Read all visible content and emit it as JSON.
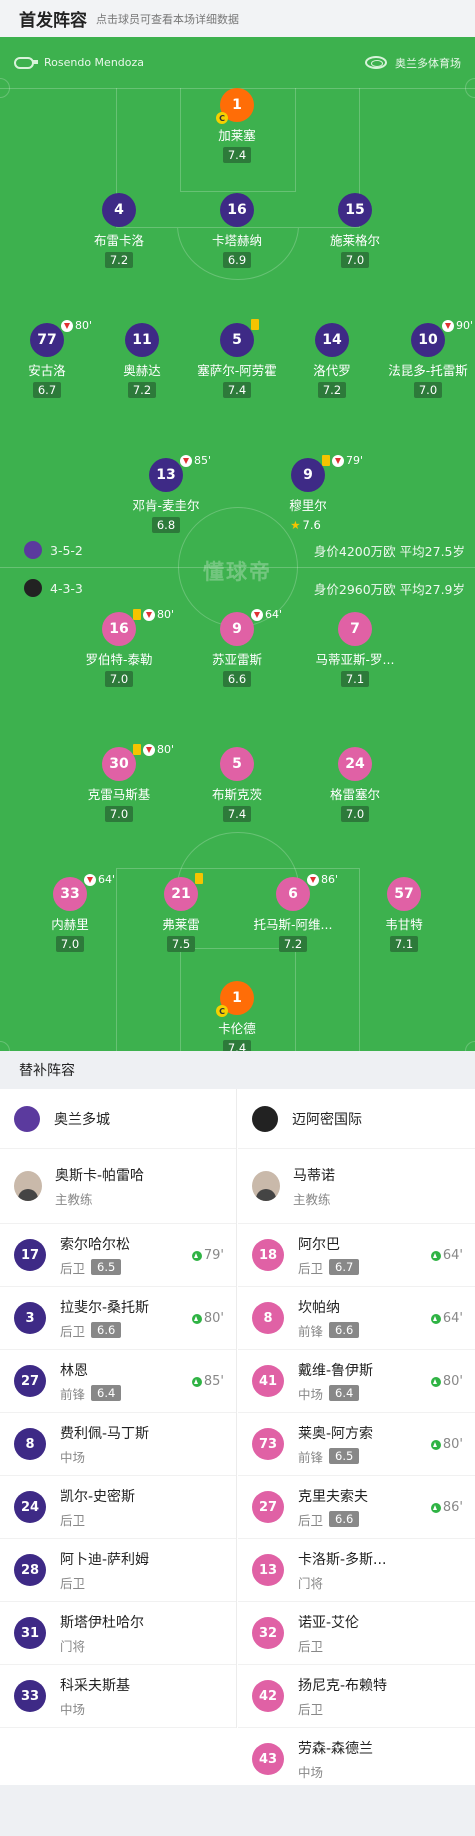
{
  "header": {
    "title": "首发阵容",
    "subtitle": "点击球员可查看本场详细数据"
  },
  "match": {
    "referee": "Rosendo Mendoza",
    "stadium": "奥兰多体育场",
    "watermark": "懂球帝"
  },
  "home": {
    "formation": "3-5-2",
    "summary": "身价4200万欧 平均27.5岁",
    "players": [
      {
        "num": "1",
        "name": "加莱塞",
        "rating": "7.4",
        "captain": "C"
      },
      {
        "num": "4",
        "name": "布雷卡洛",
        "rating": "7.2"
      },
      {
        "num": "16",
        "name": "卡塔赫纳",
        "rating": "6.9"
      },
      {
        "num": "15",
        "name": "施莱格尔",
        "rating": "7.0"
      },
      {
        "num": "77",
        "name": "安古洛",
        "rating": "6.7",
        "sub": "80'"
      },
      {
        "num": "11",
        "name": "奥赫达",
        "rating": "7.2"
      },
      {
        "num": "5",
        "name": "塞萨尔-阿劳霍",
        "rating": "7.4"
      },
      {
        "num": "14",
        "name": "洛代罗",
        "rating": "7.2"
      },
      {
        "num": "10",
        "name": "法昆多-托雷斯",
        "rating": "7.0",
        "sub": "90'"
      },
      {
        "num": "13",
        "name": "邓肯-麦圭尔",
        "rating": "6.8",
        "sub": "85'"
      },
      {
        "num": "9",
        "name": "穆里尔",
        "rating": "7.6",
        "sub": "79'"
      }
    ]
  },
  "away": {
    "formation": "4-3-3",
    "summary": "身价2960万欧 平均27.9岁",
    "players": [
      {
        "num": "16",
        "name": "罗伯特-泰勒",
        "rating": "7.0",
        "sub": "80'"
      },
      {
        "num": "9",
        "name": "苏亚雷斯",
        "rating": "6.6",
        "sub": "64'"
      },
      {
        "num": "7",
        "name": "马蒂亚斯-罗...",
        "rating": "7.1"
      },
      {
        "num": "30",
        "name": "克雷马斯基",
        "rating": "7.0",
        "sub": "80'"
      },
      {
        "num": "5",
        "name": "布斯克茨",
        "rating": "7.4"
      },
      {
        "num": "24",
        "name": "格雷塞尔",
        "rating": "7.0"
      },
      {
        "num": "33",
        "name": "内赫里",
        "rating": "7.0",
        "sub": "64'"
      },
      {
        "num": "21",
        "name": "弗莱雷",
        "rating": "7.5"
      },
      {
        "num": "6",
        "name": "托马斯-阿维...",
        "rating": "7.2",
        "sub": "86'"
      },
      {
        "num": "57",
        "name": "韦甘特",
        "rating": "7.1"
      },
      {
        "num": "1",
        "name": "卡伦德",
        "rating": "7.4",
        "captain": "C"
      }
    ]
  },
  "subs": {
    "title": "替补阵容",
    "home_team": "奥兰多城",
    "away_team": "迈阿密国际",
    "home_coach": {
      "name": "奥斯卡-帕雷哈",
      "role": "主教练"
    },
    "away_coach": {
      "name": "马蒂诺",
      "role": "主教练"
    },
    "home": [
      {
        "num": "17",
        "name": "索尔哈尔松",
        "pos": "后卫",
        "rating": "6.5",
        "time": "79'"
      },
      {
        "num": "3",
        "name": "拉斐尔-桑托斯",
        "pos": "后卫",
        "rating": "6.6",
        "time": "80'"
      },
      {
        "num": "27",
        "name": "林恩",
        "pos": "前锋",
        "rating": "6.4",
        "time": "85'"
      },
      {
        "num": "8",
        "name": "费利佩-马丁斯",
        "pos": "中场"
      },
      {
        "num": "24",
        "name": "凯尔-史密斯",
        "pos": "后卫"
      },
      {
        "num": "28",
        "name": "阿卜迪-萨利姆",
        "pos": "后卫"
      },
      {
        "num": "31",
        "name": "斯塔伊杜哈尔",
        "pos": "门将"
      },
      {
        "num": "33",
        "name": "科采夫斯基",
        "pos": "中场"
      }
    ],
    "away": [
      {
        "num": "18",
        "name": "阿尔巴",
        "pos": "后卫",
        "rating": "6.7",
        "time": "64'"
      },
      {
        "num": "8",
        "name": "坎帕纳",
        "pos": "前锋",
        "rating": "6.6",
        "time": "64'"
      },
      {
        "num": "41",
        "name": "戴维-鲁伊斯",
        "pos": "中场",
        "rating": "6.4",
        "time": "80'"
      },
      {
        "num": "73",
        "name": "莱奥-阿方索",
        "pos": "前锋",
        "rating": "6.5",
        "time": "80'"
      },
      {
        "num": "27",
        "name": "克里夫索夫",
        "pos": "后卫",
        "rating": "6.6",
        "time": "86'"
      },
      {
        "num": "13",
        "name": "卡洛斯-多斯...",
        "pos": "门将"
      },
      {
        "num": "32",
        "name": "诺亚-艾伦",
        "pos": "后卫"
      },
      {
        "num": "42",
        "name": "扬尼克-布赖特",
        "pos": "后卫"
      },
      {
        "num": "43",
        "name": "劳森-森德兰",
        "pos": "中场"
      }
    ]
  },
  "colors": {
    "pitch": "#3db14e",
    "home": "#3e2a86",
    "away": "#e061a5",
    "goalkeeper": "#ff6d07"
  }
}
